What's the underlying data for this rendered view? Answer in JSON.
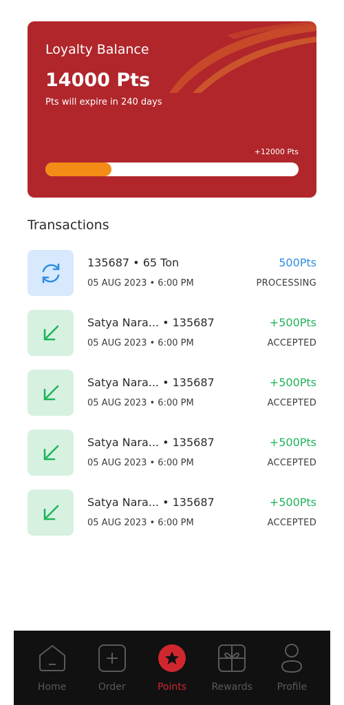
{
  "balance": {
    "title": "Loyalty Balance",
    "points": "14000 Pts",
    "expiry": "Pts will expire in 240 days",
    "bonus_label": "+12000 Pts",
    "progress_percent": 26
  },
  "transactions": {
    "title": "Transactions",
    "items": [
      {
        "type": "processing",
        "title": "135687 • 65 Ton",
        "date": "05 AUG 2023 • 6:00 PM",
        "amount": "500Pts",
        "status": "PROCESSING"
      },
      {
        "type": "accepted",
        "title": "Satya Nara... • 135687",
        "date": "05 AUG 2023 • 6:00 PM",
        "amount": "+500Pts",
        "status": "ACCEPTED"
      },
      {
        "type": "accepted",
        "title": "Satya Nara... • 135687",
        "date": "05 AUG 2023 • 6:00 PM",
        "amount": "+500Pts",
        "status": "ACCEPTED"
      },
      {
        "type": "accepted",
        "title": "Satya Nara... • 135687",
        "date": "05 AUG 2023 • 6:00 PM",
        "amount": "+500Pts",
        "status": "ACCEPTED"
      },
      {
        "type": "accepted",
        "title": "Satya Nara... • 135687",
        "date": "05 AUG 2023 • 6:00 PM",
        "amount": "+500Pts",
        "status": "ACCEPTED"
      }
    ]
  },
  "nav": {
    "items": [
      {
        "label": "Home",
        "icon": "home-icon"
      },
      {
        "label": "Order",
        "icon": "plus-square-icon"
      },
      {
        "label": "Points",
        "icon": "star-badge-icon",
        "active": true
      },
      {
        "label": "Rewards",
        "icon": "gift-icon"
      },
      {
        "label": "Profile",
        "icon": "user-icon"
      }
    ]
  },
  "colors": {
    "brand_red": "#b0262b",
    "progress": "#f28c16",
    "processing_blue": "#2f8de4",
    "accepted_green": "#1fb35a"
  }
}
